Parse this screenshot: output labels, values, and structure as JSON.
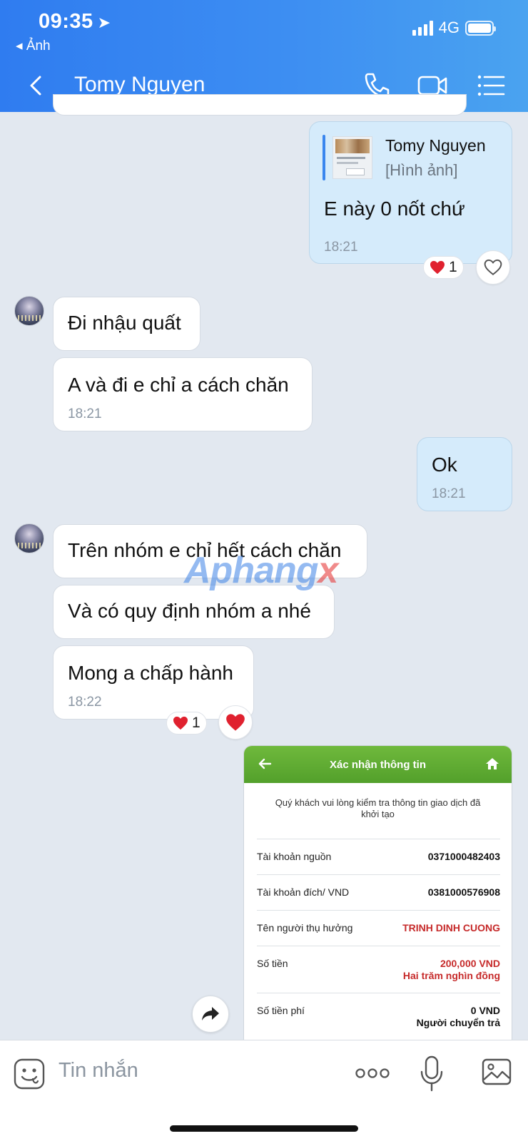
{
  "status_bar": {
    "time": "09:35",
    "location_glyph": "➤",
    "back_app": "◂ Ảnh",
    "network": "4G"
  },
  "header": {
    "contact_name": "Tomy Nguyen",
    "icons": [
      "back-chevron-icon",
      "phone-icon",
      "video-call-icon",
      "menu-list-icon"
    ]
  },
  "messages": {
    "quoted_reply": {
      "quote_author": "Tomy Nguyen",
      "quote_type": "[Hình ảnh]",
      "text": "E này 0 nốt chứ",
      "time": "18:21",
      "reaction_count": "1"
    },
    "m1": {
      "text": "Đi nhậu quất"
    },
    "m2": {
      "text": "A và đi e chỉ a cách chăn",
      "time": "18:21"
    },
    "m3": {
      "text": "Ok",
      "time": "18:21"
    },
    "m4": {
      "text": "Trên nhóm e chỉ hết cách chăn"
    },
    "m5": {
      "text": "Và có quy định nhóm a nhé"
    },
    "m6": {
      "text": "Mong a chấp hành",
      "time": "18:22",
      "reaction_count": "1"
    }
  },
  "bank_screenshot": {
    "title": "Xác nhận thông tin",
    "intro": "Quý khách vui lòng kiểm tra thông tin giao dịch đã khởi tạo",
    "rows": [
      {
        "label": "Tài khoản nguồn",
        "value": "0371000482403"
      },
      {
        "label": "Tài khoản đích/ VND",
        "value": "0381000576908"
      },
      {
        "label": "Tên người thụ hưởng",
        "value": "TRINH DINH CUONG"
      },
      {
        "label": "Số tiền",
        "value": "200,000 VND",
        "value2": "Hai trăm nghìn đồng"
      },
      {
        "label": "Số tiền phí",
        "value": "0 VND",
        "value2": "Người chuyển trả"
      }
    ],
    "accent_color": "#5aa630",
    "amount_color": "#c62a2a"
  },
  "watermark": {
    "main": "Aphang",
    "suffix": "x"
  },
  "composer": {
    "placeholder": "Tin nhắn"
  },
  "colors": {
    "header": "#3a86ee",
    "my_bubble": "#d5ebfb",
    "background": "#e2e8f0",
    "heart": "#e0212f"
  }
}
